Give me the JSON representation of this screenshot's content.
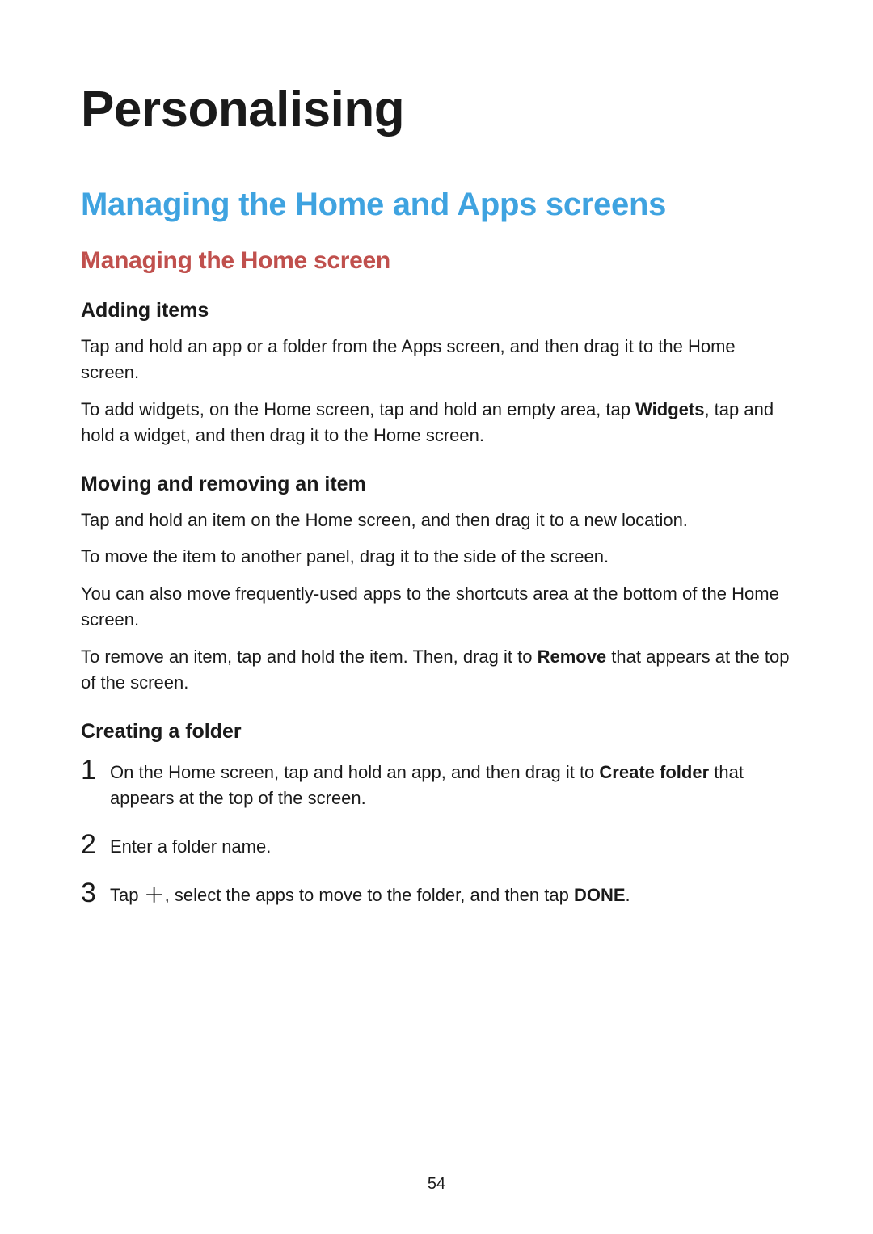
{
  "page_number": "54",
  "chapter_title": "Personalising",
  "section_title": "Managing the Home and Apps screens",
  "sub_title": "Managing the Home screen",
  "adding_items": {
    "heading": "Adding items",
    "p1": "Tap and hold an app or a folder from the Apps screen, and then drag it to the Home screen.",
    "p2_before": "To add widgets, on the Home screen, tap and hold an empty area, tap ",
    "p2_bold": "Widgets",
    "p2_after": ", tap and hold a widget, and then drag it to the Home screen."
  },
  "moving_removing": {
    "heading": "Moving and removing an item",
    "p1": "Tap and hold an item on the Home screen, and then drag it to a new location.",
    "p2": "To move the item to another panel, drag it to the side of the screen.",
    "p3": "You can also move frequently-used apps to the shortcuts area at the bottom of the Home screen.",
    "p4_before": "To remove an item, tap and hold the item. Then, drag it to ",
    "p4_bold": "Remove",
    "p4_after": " that appears at the top of the screen."
  },
  "creating_folder": {
    "heading": "Creating a folder",
    "step1_num": "1",
    "step1_before": "On the Home screen, tap and hold an app, and then drag it to ",
    "step1_bold": "Create folder",
    "step1_after": " that appears at the top of the screen.",
    "step2_num": "2",
    "step2_text": "Enter a folder name.",
    "step3_num": "3",
    "step3_before": "Tap ",
    "step3_after_icon_before_bold": ", select the apps to move to the folder, and then tap ",
    "step3_bold": "DONE",
    "step3_final": "."
  }
}
